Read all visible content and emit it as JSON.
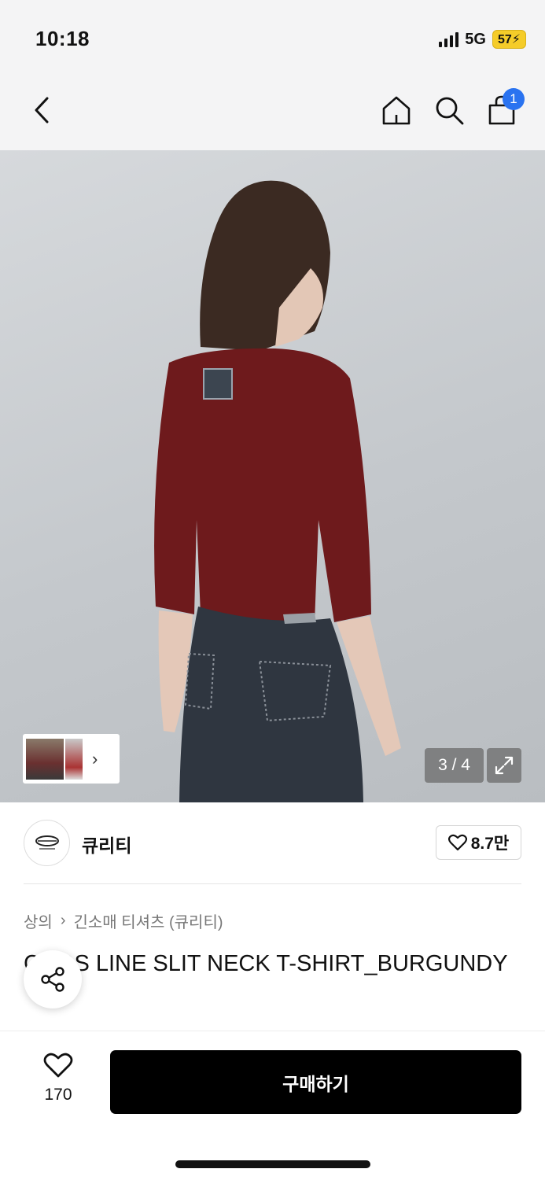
{
  "status": {
    "time": "10:18",
    "network": "5G",
    "battery": "57"
  },
  "nav": {
    "cart_count": "1"
  },
  "gallery": {
    "counter": "3 / 4"
  },
  "brand": {
    "name": "큐리티",
    "likes": "8.7만"
  },
  "breadcrumb": {
    "level1": "상의",
    "level2": "긴소매 티셔츠 (큐리티)"
  },
  "product": {
    "title": "CROS LINE SLIT NECK T-SHIRT_BURGUNDY"
  },
  "bottom": {
    "wish_count": "170",
    "buy_label": "구매하기"
  },
  "colors": {
    "accent_badge": "#2a73f0",
    "buy_button": "#000000",
    "shirt": "#6e1a1c"
  }
}
